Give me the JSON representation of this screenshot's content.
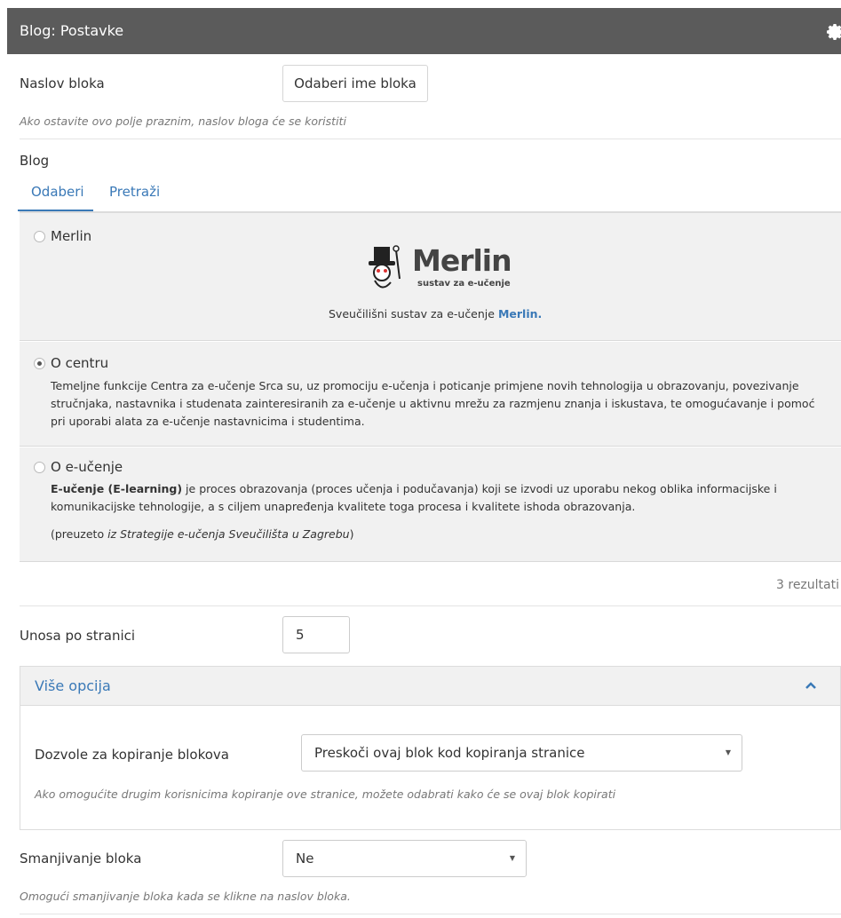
{
  "header": {
    "title": "Blog: Postavke"
  },
  "block_title": {
    "label": "Naslov bloka",
    "button": "Odaberi ime bloka",
    "hint": "Ako ostavite ovo polje praznim, naslov bloga će se koristiti"
  },
  "blog": {
    "label": "Blog",
    "tabs": [
      "Odaberi",
      "Pretraži"
    ],
    "results": [
      {
        "title": "Merlin",
        "checked": false,
        "logo_word": "Merlin",
        "logo_sub": "sustav za e-učenje",
        "caption_prefix": "Sveučilišni sustav za e-učenje",
        "caption_link": "Merlin."
      },
      {
        "title": "O centru",
        "checked": true,
        "text": "Temeljne funkcije Centra za e-učenje Srca su, uz promociju e-učenja i poticanje primjene novih tehnologija u obrazovanju, povezivanje stručnjaka, nastavnika i studenata zainteresiranih za e-učenje u aktivnu mrežu za razmjenu znanja i iskustava, te omogućavanje i pomoć pri uporabi alata za e-učenje nastavnicima i studentima."
      },
      {
        "title": "O e-učenje",
        "checked": false,
        "bold": "E-učenje (E-learning)",
        "text": " je proces obrazovanja (proces učenja i podučavanja) koji se izvodi uz uporabu nekog oblika informacijske i komunikacijske tehnologije, a s ciljem unapređenja kvalitete toga procesa i kvalitete ishoda obrazovanja.",
        "source_prefix": "(preuzeto ",
        "source_italic": "iz Strategije e-učenja Sveučilišta u Zagrebu",
        "source_suffix": ")"
      }
    ],
    "count": "3 rezultati"
  },
  "per_page": {
    "label": "Unosa po stranici",
    "value": "5"
  },
  "more_options": {
    "title": "Više opcija",
    "copy_label": "Dozvole za kopiranje blokova",
    "copy_value": "Preskoči ovaj blok kod kopiranja stranice",
    "copy_hint": "Ako omogućite drugim korisnicima kopiranje ove stranice, možete odabrati kako će se ovaj blok kopirati"
  },
  "minimize": {
    "label": "Smanjivanje bloka",
    "value": "Ne",
    "hint": "Omogući smanjivanje bloka kada se klikne na naslov bloka."
  },
  "colors": {
    "header_bg": "#5b5b5b",
    "link": "#3a79b7",
    "panel_bg": "#f1f1f1"
  },
  "icons": [
    "gear-icon",
    "chevron-up-icon",
    "caret-down-icon",
    "merlin-logo"
  ]
}
